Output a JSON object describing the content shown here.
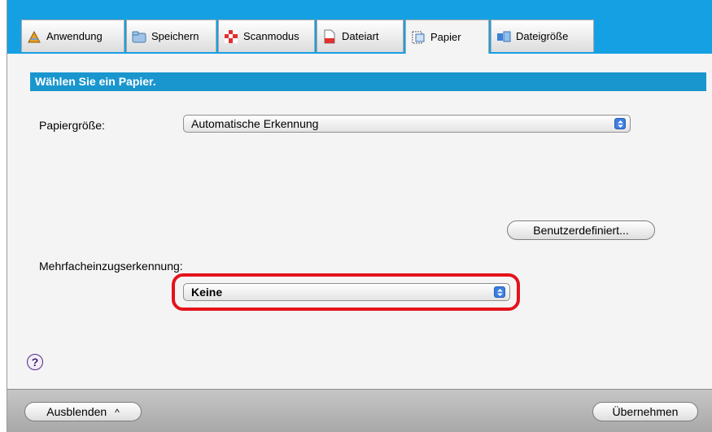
{
  "tabs": [
    {
      "label": "Anwendung",
      "icon": "application-icon",
      "active": false
    },
    {
      "label": "Speichern",
      "icon": "folder-icon",
      "active": false
    },
    {
      "label": "Scanmodus",
      "icon": "scan-mode-icon",
      "active": false
    },
    {
      "label": "Dateiart",
      "icon": "file-type-icon",
      "active": false
    },
    {
      "label": "Papier",
      "icon": "paper-icon",
      "active": true
    },
    {
      "label": "Dateigröße",
      "icon": "file-size-icon",
      "active": false
    }
  ],
  "section": {
    "title": "Wählen Sie ein Papier."
  },
  "paper_size": {
    "label": "Papiergröße:",
    "value": "Automatische Erkennung"
  },
  "custom_button": {
    "label": "Benutzerdefiniert..."
  },
  "multifeed": {
    "label": "Mehrfacheinzugserkennung:",
    "value": "Keine"
  },
  "help": {
    "label": "?"
  },
  "footer": {
    "hide_label": "Ausblenden",
    "hide_chevron": "^",
    "apply_label": "Übernehmen"
  },
  "colors": {
    "accent": "#16a0e4",
    "header": "#1a96cf",
    "highlight": "#e4131b"
  }
}
